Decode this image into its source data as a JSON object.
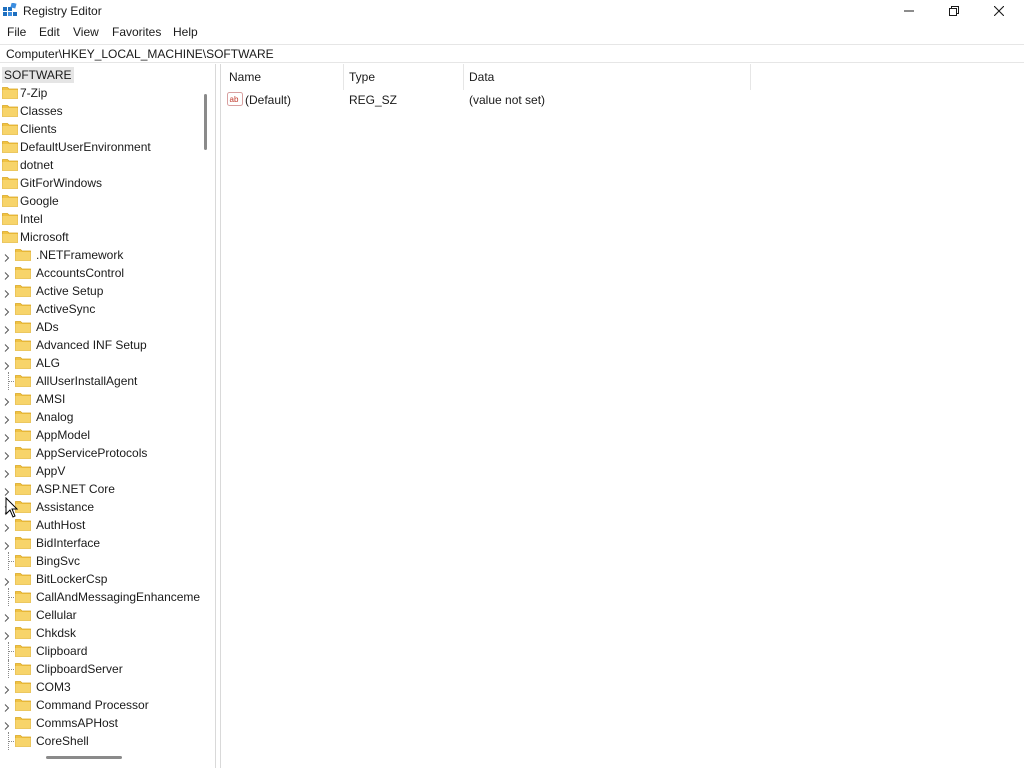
{
  "window": {
    "title": "Registry Editor",
    "minimize_icon": "minimize-icon",
    "maximize_icon": "restore-icon",
    "close_icon": "close-icon"
  },
  "menu": [
    "File",
    "Edit",
    "View",
    "Favorites",
    "Help"
  ],
  "address": "Computer\\HKEY_LOCAL_MACHINE\\SOFTWARE",
  "tree": {
    "root": "SOFTWARE",
    "top_level": [
      "7-Zip",
      "Classes",
      "Clients",
      "DefaultUserEnvironment",
      "dotnet",
      "GitForWindows",
      "Google",
      "Intel",
      "Microsoft"
    ],
    "microsoft_children": [
      {
        "label": ".NETFramework",
        "expandable": true
      },
      {
        "label": "AccountsControl",
        "expandable": true
      },
      {
        "label": "Active Setup",
        "expandable": true
      },
      {
        "label": "ActiveSync",
        "expandable": true
      },
      {
        "label": "ADs",
        "expandable": true
      },
      {
        "label": "Advanced INF Setup",
        "expandable": true
      },
      {
        "label": "ALG",
        "expandable": true
      },
      {
        "label": "AllUserInstallAgent",
        "expandable": false
      },
      {
        "label": "AMSI",
        "expandable": true
      },
      {
        "label": "Analog",
        "expandable": true
      },
      {
        "label": "AppModel",
        "expandable": true
      },
      {
        "label": "AppServiceProtocols",
        "expandable": true
      },
      {
        "label": "AppV",
        "expandable": true
      },
      {
        "label": "ASP.NET Core",
        "expandable": true
      },
      {
        "label": "Assistance",
        "expandable": true
      },
      {
        "label": "AuthHost",
        "expandable": true
      },
      {
        "label": "BidInterface",
        "expandable": true
      },
      {
        "label": "BingSvc",
        "expandable": false
      },
      {
        "label": "BitLockerCsp",
        "expandable": true
      },
      {
        "label": "CallAndMessagingEnhanceme",
        "expandable": false
      },
      {
        "label": "Cellular",
        "expandable": true
      },
      {
        "label": "Chkdsk",
        "expandable": true
      },
      {
        "label": "Clipboard",
        "expandable": false
      },
      {
        "label": "ClipboardServer",
        "expandable": false
      },
      {
        "label": "COM3",
        "expandable": true
      },
      {
        "label": "Command Processor",
        "expandable": true
      },
      {
        "label": "CommsAPHost",
        "expandable": true
      },
      {
        "label": "CoreShell",
        "expandable": false
      }
    ]
  },
  "list": {
    "columns": [
      "Name",
      "Type",
      "Data"
    ],
    "rows": [
      {
        "name": "(Default)",
        "type": "REG_SZ",
        "data": "(value not set)",
        "icon": "string-value-icon"
      }
    ]
  },
  "colors": {
    "folder": "#f0c242",
    "selected_bg": "#e5e5e5",
    "app_icon": "#1e6fbf"
  }
}
